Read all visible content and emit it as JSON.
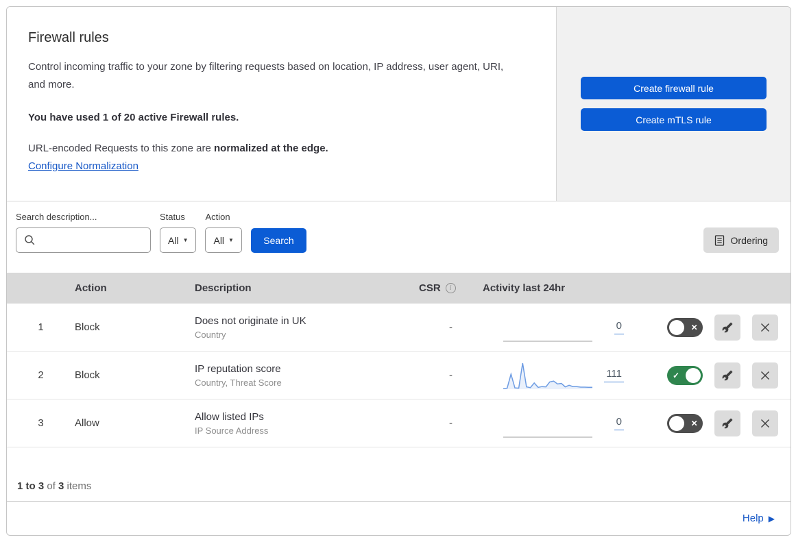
{
  "header": {
    "title": "Firewall rules",
    "description": "Control incoming traffic to your zone by filtering requests based on location, IP address, user agent, URI, and more.",
    "usage_notice": "You have used 1 of 20 active Firewall rules.",
    "normalization_text": "URL-encoded Requests to this zone are ",
    "normalization_bold": "normalized at the edge.",
    "normalization_link": "Configure Normalization",
    "create_firewall_button": "Create firewall rule",
    "create_mtls_button": "Create mTLS rule"
  },
  "filters": {
    "search_label": "Search description...",
    "status_label": "Status",
    "status_value": "All",
    "action_label": "Action",
    "action_value": "All",
    "search_button": "Search",
    "ordering_button": "Ordering"
  },
  "table": {
    "columns": {
      "action": "Action",
      "description": "Description",
      "csr": "CSR",
      "activity": "Activity last 24hr"
    },
    "rows": [
      {
        "num": "1",
        "action": "Block",
        "description": "Does not originate in UK",
        "fields": "Country",
        "csr": "-",
        "count": "0",
        "enabled": false,
        "activity": [
          0,
          0,
          0,
          0,
          0,
          0,
          0,
          0,
          0,
          0,
          0,
          0,
          0,
          0,
          0,
          0,
          0,
          0,
          0,
          0,
          0,
          0,
          0,
          0
        ]
      },
      {
        "num": "2",
        "action": "Block",
        "description": "IP reputation score",
        "fields": "Country, Threat Score",
        "csr": "-",
        "count": "111",
        "enabled": true,
        "activity": [
          2,
          4,
          58,
          5,
          4,
          100,
          9,
          6,
          24,
          7,
          10,
          9,
          28,
          31,
          20,
          22,
          9,
          15,
          10,
          10,
          8,
          8,
          7,
          7
        ]
      },
      {
        "num": "3",
        "action": "Allow",
        "description": "Allow listed IPs",
        "fields": "IP Source Address",
        "csr": "-",
        "count": "0",
        "enabled": false,
        "activity": [
          0,
          0,
          0,
          0,
          0,
          0,
          0,
          0,
          0,
          0,
          0,
          0,
          0,
          0,
          0,
          0,
          0,
          0,
          0,
          0,
          0,
          0,
          0,
          0
        ]
      }
    ]
  },
  "footer": {
    "range_bold": "1 to 3",
    "of_text": " of ",
    "total_bold": "3",
    "items_text": " items",
    "help_label": "Help"
  },
  "icons": {
    "caret_down": "▼",
    "check": "✓",
    "close_x": "×",
    "help_arrow": "▶",
    "info": "i"
  },
  "colors": {
    "primary_blue": "#0b5cd5",
    "link_blue": "#1758c7",
    "toggle_on_green": "#2f854e",
    "toggle_off_gray": "#4d4d4d",
    "sparkline_blue": "#6d9ce3",
    "table_header_gray": "#d9d9d9",
    "panel_gray": "#f1f1f1"
  }
}
